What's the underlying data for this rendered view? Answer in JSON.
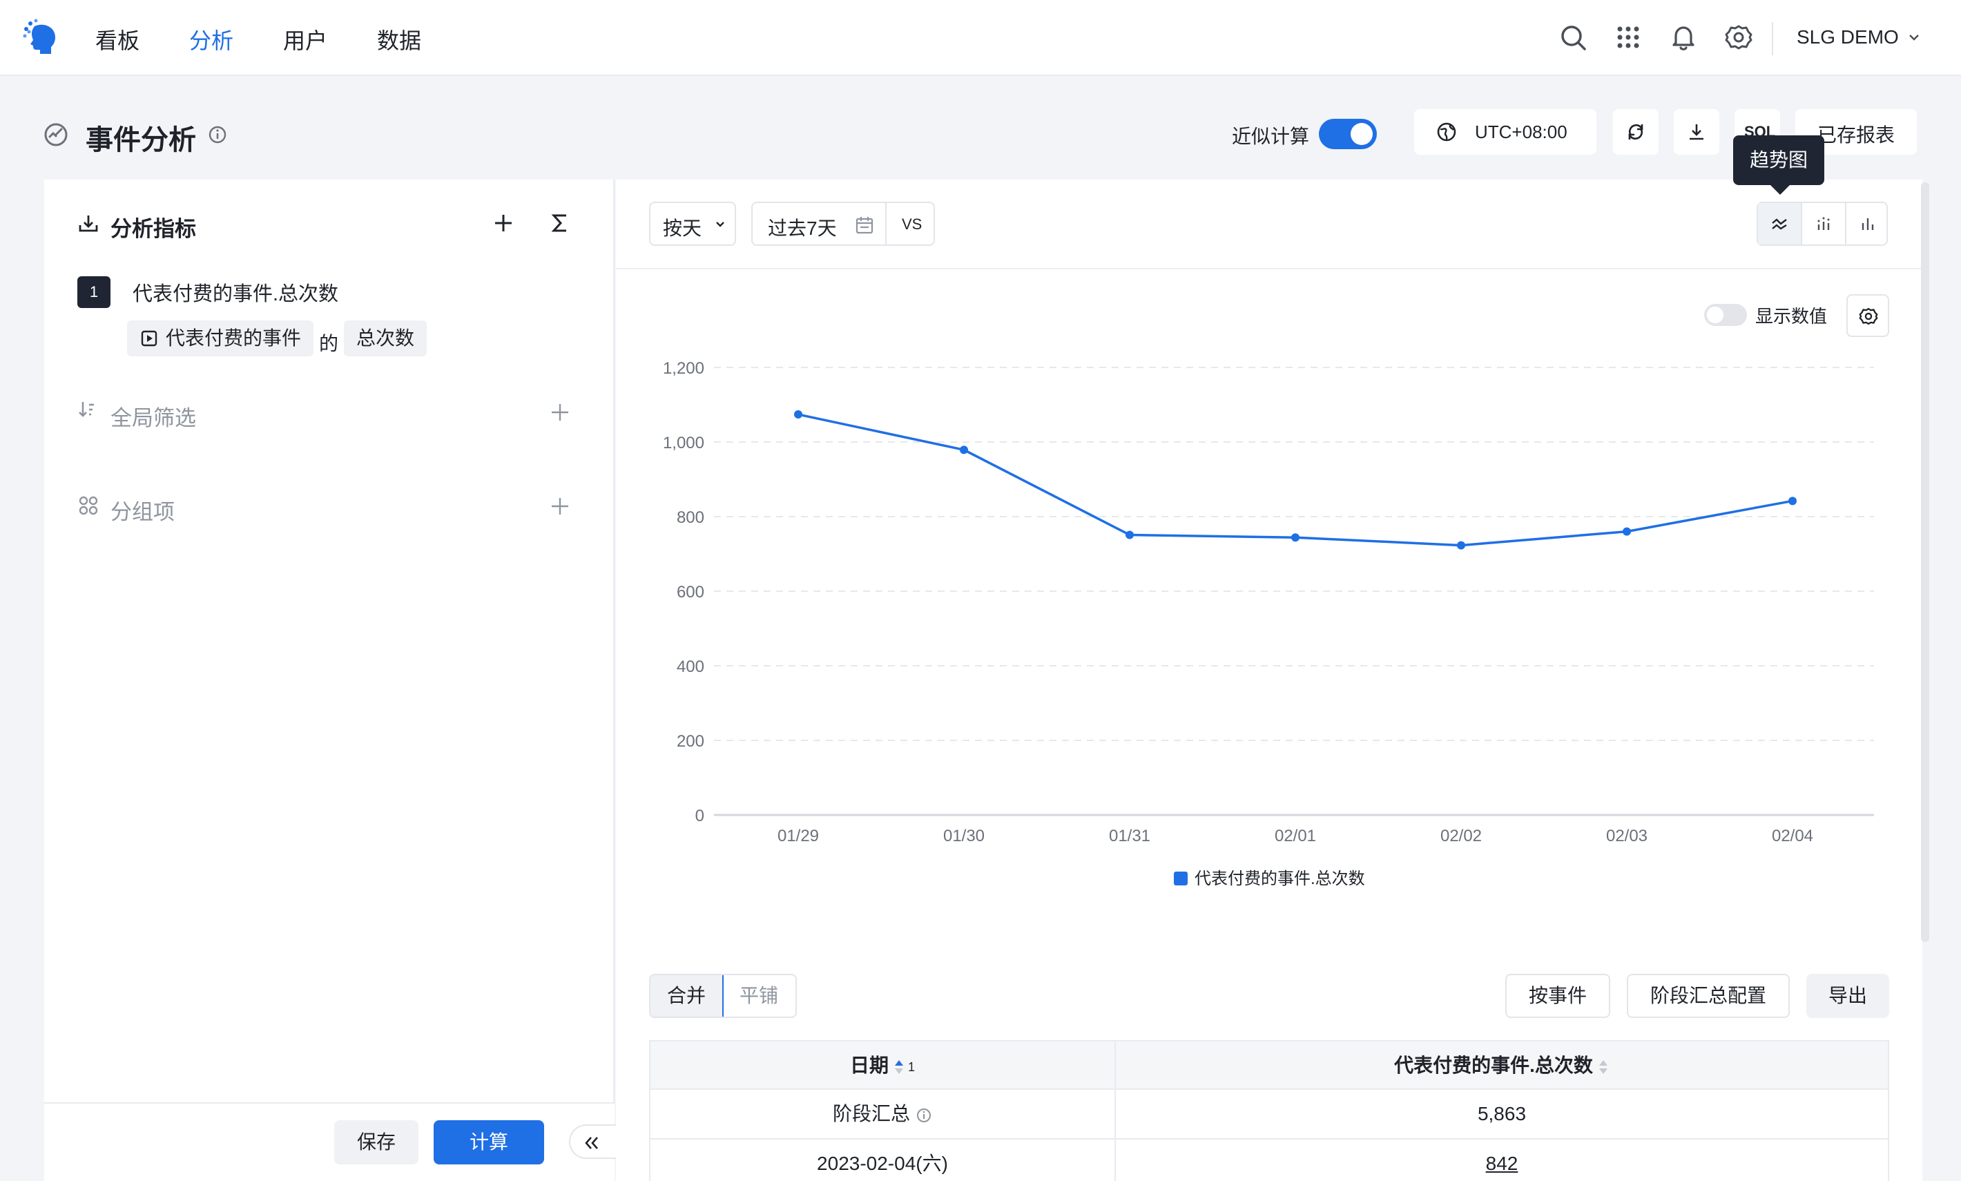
{
  "nav": {
    "items": [
      {
        "label": "看板"
      },
      {
        "label": "分析"
      },
      {
        "label": "用户"
      },
      {
        "label": "数据"
      }
    ],
    "active_index": 1,
    "project": "SLG DEMO"
  },
  "header": {
    "title": "事件分析",
    "approx_label": "近似计算",
    "approx_on": true,
    "timezone": "UTC+08:00",
    "sql_label": "SQL",
    "saved_reports": "已存报表"
  },
  "tooltip": "趋势图",
  "left": {
    "metrics_title": "分析指标",
    "metric": {
      "index": "1",
      "name": "代表付费的事件.总次数",
      "event_chip": "代表付费的事件",
      "of": "的",
      "agg_chip": "总次数"
    },
    "filter_title": "全局筛选",
    "group_title": "分组项",
    "save": "保存",
    "calc": "计算"
  },
  "toolbar": {
    "granularity": "按天",
    "range": "过去7天",
    "vs": "VS"
  },
  "chart_options": {
    "show_values": "显示数值",
    "show_values_on": false
  },
  "chart_data": {
    "type": "line",
    "x": [
      "01/29",
      "01/30",
      "01/31",
      "02/01",
      "02/02",
      "02/03",
      "02/04"
    ],
    "series": [
      {
        "name": "代表付费的事件.总次数",
        "values": [
          1074,
          979,
          751,
          744,
          723,
          760,
          842
        ],
        "color": "#1f6fe5"
      }
    ],
    "yticks": [
      "0",
      "200",
      "400",
      "600",
      "800",
      "1,000",
      "1,200"
    ],
    "ylim": [
      0,
      1200
    ],
    "grid": true,
    "legend": "bottom"
  },
  "table_controls": {
    "merge": "合并",
    "tile": "平铺",
    "by_event": "按事件",
    "stage_config": "阶段汇总配置",
    "export": "导出"
  },
  "table": {
    "headers": {
      "date": "日期",
      "date_sort_index": "1",
      "metric": "代表付费的事件.总次数"
    },
    "rows": [
      {
        "date": "阶段汇总",
        "value": "5,863"
      },
      {
        "date": "2023-02-04(六)",
        "value": "842"
      }
    ]
  }
}
